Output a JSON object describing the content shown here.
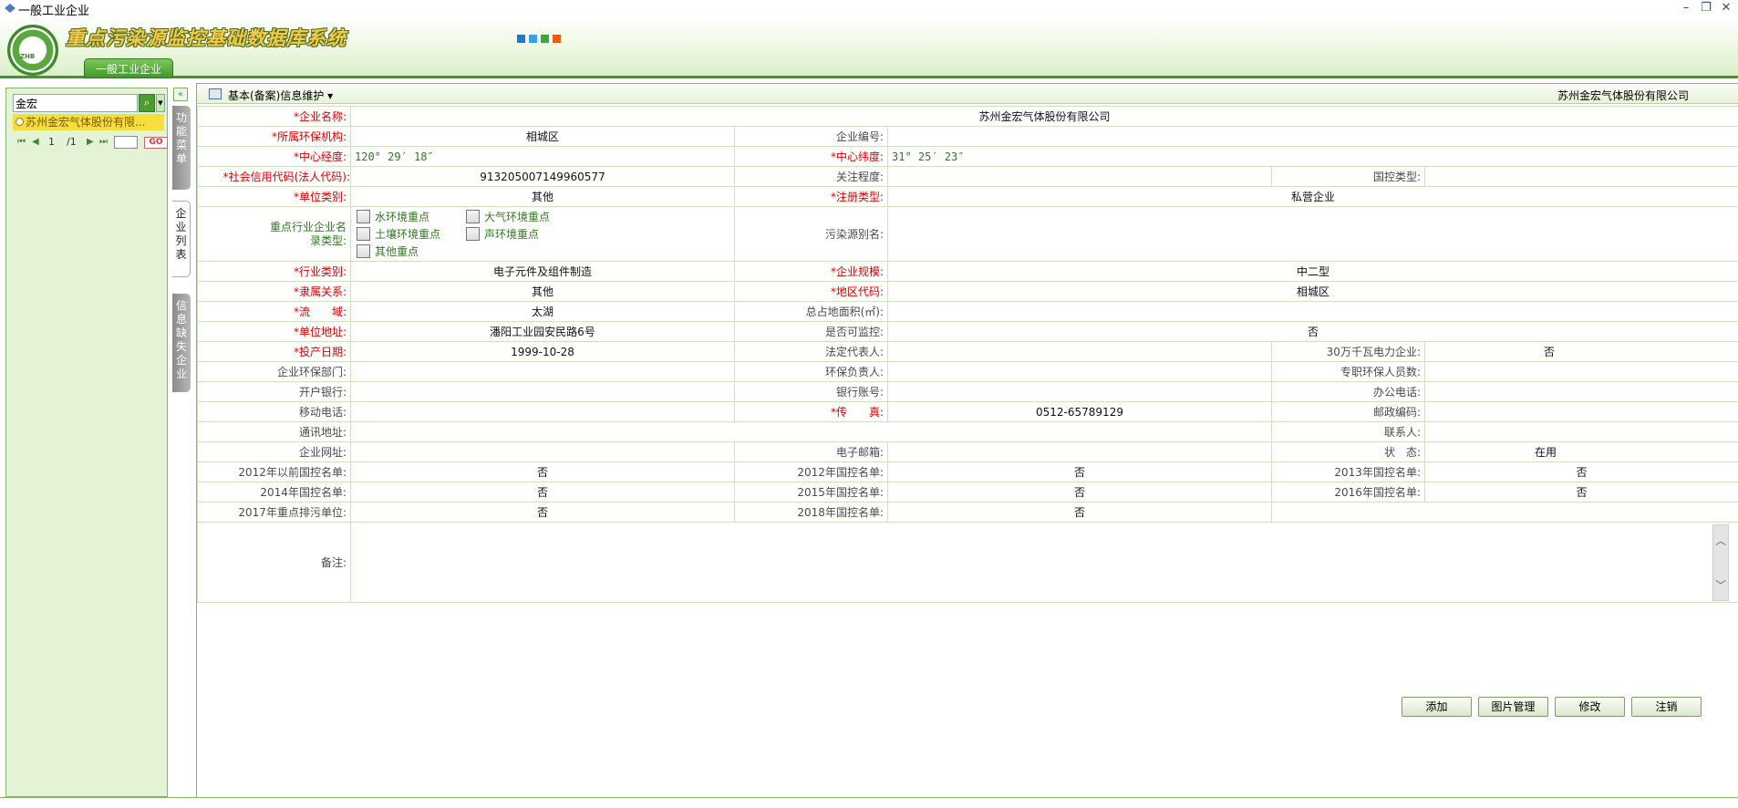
{
  "window": {
    "title": "一般工业企业",
    "minimize": "–",
    "restore": "❐",
    "close": "✕"
  },
  "header": {
    "system_title": "重点污染源监控基础数据库系统",
    "logo_text": "ZHB",
    "color_squares": [
      "#1f78c8",
      "#3aa0e0",
      "#3ea63e",
      "#e85c14"
    ],
    "top_tab": "一般工业企业"
  },
  "left_panel": {
    "search_value": "金宏",
    "search_icon": "search-icon",
    "result_item": "苏州金宏气体股份有限...",
    "pager": {
      "first": "⏮",
      "prev": "◀",
      "page": "1",
      "slash": "/1",
      "next": "▶",
      "last": "⏭",
      "go": "GO"
    }
  },
  "side_tabs": {
    "collapse": "«",
    "tab1": [
      "功",
      "能",
      "菜",
      "单"
    ],
    "tab2": [
      "企",
      "业",
      "列",
      "表"
    ],
    "tab3": [
      "信",
      "息",
      "缺",
      "失",
      "企",
      "业"
    ]
  },
  "main": {
    "title": "基本(备案)信息维护 ▾",
    "company": "苏州金宏气体股份有限公司"
  },
  "form": {
    "enterprise_name": {
      "label": "*企业名称:",
      "value": "苏州金宏气体股份有限公司"
    },
    "env_agency": {
      "label": "*所属环保机构:",
      "value": "相城区"
    },
    "enterprise_code": {
      "label": "企业编号:",
      "value": ""
    },
    "longitude": {
      "label": "*中心经度:",
      "value": "120° 29′ 18″"
    },
    "latitude": {
      "label": "*中心纬度:",
      "value": "31° 25′ 23″"
    },
    "credit_code": {
      "label": "*社会信用代码(法人代码):",
      "value": "913205007149960577"
    },
    "attention_level": {
      "label": "关注程度:",
      "value": ""
    },
    "national_control_type": {
      "label": "国控类型:",
      "value": ""
    },
    "unit_category": {
      "label": "*单位类别:",
      "value": "其他"
    },
    "registration_type": {
      "label": "*注册类型:",
      "value": "私营企业"
    },
    "key_industry": {
      "label": "重点行业企业名录类型:",
      "options": [
        "水环境重点",
        "大气环境重点",
        "土壤环境重点",
        "声环境重点",
        "其他重点"
      ]
    },
    "pollution_alias": {
      "label": "污染源别名:",
      "value": ""
    },
    "industry_category": {
      "label": "*行业类别:",
      "value": "电子元件及组件制造"
    },
    "enterprise_scale": {
      "label": "*企业规模:",
      "value": "中二型"
    },
    "affiliation": {
      "label": "*隶属关系:",
      "value": "其他"
    },
    "region_code": {
      "label": "*地区代码:",
      "value": "相城区"
    },
    "basin": {
      "label": "*流　　域:",
      "value": "太湖"
    },
    "floor_area": {
      "label": "总占地面积(㎡):",
      "value": ""
    },
    "unit_address": {
      "label": "*单位地址:",
      "value": "潘阳工业园安民路6号"
    },
    "monitorable": {
      "label": "是否可监控:",
      "value": "否"
    },
    "production_date": {
      "label": "*投产日期:",
      "value": "1999-10-28"
    },
    "legal_rep": {
      "label": "法定代表人:",
      "value": ""
    },
    "power_300mw": {
      "label": "30万千瓦电力企业:",
      "value": "否"
    },
    "env_dept": {
      "label": "企业环保部门:",
      "value": ""
    },
    "env_manager": {
      "label": "环保负责人:",
      "value": ""
    },
    "env_staff": {
      "label": "专职环保人员数:",
      "value": ""
    },
    "bank": {
      "label": "开户银行:",
      "value": ""
    },
    "bank_account": {
      "label": "银行账号:",
      "value": ""
    },
    "office_phone": {
      "label": "办公电话:",
      "value": ""
    },
    "mobile": {
      "label": "移动电话:",
      "value": ""
    },
    "fax": {
      "label": "*传　　真:",
      "value": "0512-65789129"
    },
    "postcode": {
      "label": "邮政编码:",
      "value": ""
    },
    "mail_address": {
      "label": "通讯地址:",
      "value": ""
    },
    "contact": {
      "label": "联系人:",
      "value": ""
    },
    "website": {
      "label": "企业网址:",
      "value": ""
    },
    "email": {
      "label": "电子邮箱:",
      "value": ""
    },
    "status": {
      "label": "状　态:",
      "value": "在用"
    },
    "list_pre2012": {
      "label": "2012年以前国控名单:",
      "value": "否"
    },
    "list_2012": {
      "label": "2012年国控名单:",
      "value": "否"
    },
    "list_2013": {
      "label": "2013年国控名单:",
      "value": "否"
    },
    "list_2014": {
      "label": "2014年国控名单:",
      "value": "否"
    },
    "list_2015": {
      "label": "2015年国控名单:",
      "value": "否"
    },
    "list_2016": {
      "label": "2016年国控名单:",
      "value": "否"
    },
    "key_2017": {
      "label": "2017年重点排污单位:",
      "value": "否"
    },
    "list_2018": {
      "label": "2018年国控名单:",
      "value": "否"
    },
    "notes": {
      "label": "备注:",
      "value": ""
    }
  },
  "actions": {
    "add": "添加",
    "images": "图片管理",
    "edit": "修改",
    "cancel": "注销"
  }
}
